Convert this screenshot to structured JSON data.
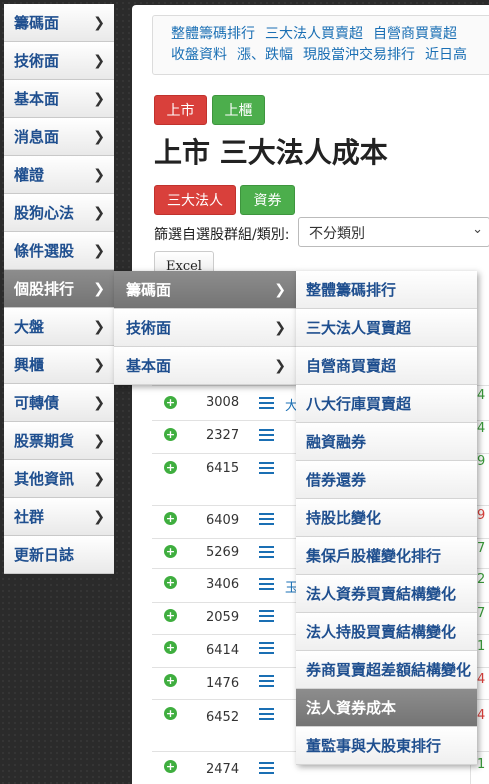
{
  "sidebar": {
    "items": [
      {
        "label": "籌碼面"
      },
      {
        "label": "技術面"
      },
      {
        "label": "基本面"
      },
      {
        "label": "消息面"
      },
      {
        "label": "權證"
      },
      {
        "label": "股狗心法"
      },
      {
        "label": "條件選股"
      },
      {
        "label": "個股排行"
      },
      {
        "label": "大盤"
      },
      {
        "label": "興櫃"
      },
      {
        "label": "可轉債"
      },
      {
        "label": "股票期貨"
      },
      {
        "label": "其他資訊"
      },
      {
        "label": "社群"
      },
      {
        "label": "更新日誌"
      }
    ]
  },
  "quicklinks": {
    "row1": [
      "整體籌碼排行",
      "三大法人買賣超",
      "自營商買賣超"
    ],
    "row2": [
      "收盤資料",
      "漲、跌幅",
      "現股當沖交易排行",
      "近日高"
    ]
  },
  "market_buttons": {
    "listed": "上市",
    "otc": "上櫃"
  },
  "page_title": "上市 三大法人成本",
  "type_buttons": {
    "institutional": "三大法人",
    "margin": "資券"
  },
  "filter": {
    "label": "篩選自選股群組/類別:",
    "selected": "不分類別"
  },
  "excel_label": "Excel",
  "table": {
    "rows": [
      {
        "code": "3008",
        "name": "大",
        "val": "4"
      },
      {
        "code": "2327",
        "name": "",
        "val": "4"
      },
      {
        "code": "6415",
        "name": "",
        "val": "9"
      },
      {
        "code": "6409",
        "name": "",
        "val": "9"
      },
      {
        "code": "5269",
        "name": "",
        "val": "7"
      },
      {
        "code": "3406",
        "name": "玉",
        "val": "2"
      },
      {
        "code": "2059",
        "name": "",
        "val": "7"
      },
      {
        "code": "6414",
        "name": "",
        "val": "1"
      },
      {
        "code": "1476",
        "name": "",
        "val": "4"
      },
      {
        "code": "6452",
        "name": "",
        "val": "4"
      },
      {
        "code": "2474",
        "name": "",
        "val": "1"
      }
    ]
  },
  "submenu": {
    "items": [
      {
        "label": "籌碼面"
      },
      {
        "label": "技術面"
      },
      {
        "label": "基本面"
      }
    ]
  },
  "subsubmenu": {
    "items": [
      {
        "label": "整體籌碼排行"
      },
      {
        "label": "三大法人買賣超"
      },
      {
        "label": "自營商買賣超"
      },
      {
        "label": "八大行庫買賣超"
      },
      {
        "label": "融資融券"
      },
      {
        "label": "借券還券"
      },
      {
        "label": "持股比變化"
      },
      {
        "label": "集保戶股權變化排行"
      },
      {
        "label": "法人資券買賣結構變化"
      },
      {
        "label": "法人持股買賣結構變化"
      },
      {
        "label": "券商買賣超差額結構變化"
      },
      {
        "label": "法人資券成本"
      },
      {
        "label": "董監事與大股東排行"
      }
    ]
  },
  "colors": {
    "accent_blue": "#1a6fb4",
    "positive": "#3a9a3a",
    "negative": "#d9403b"
  }
}
